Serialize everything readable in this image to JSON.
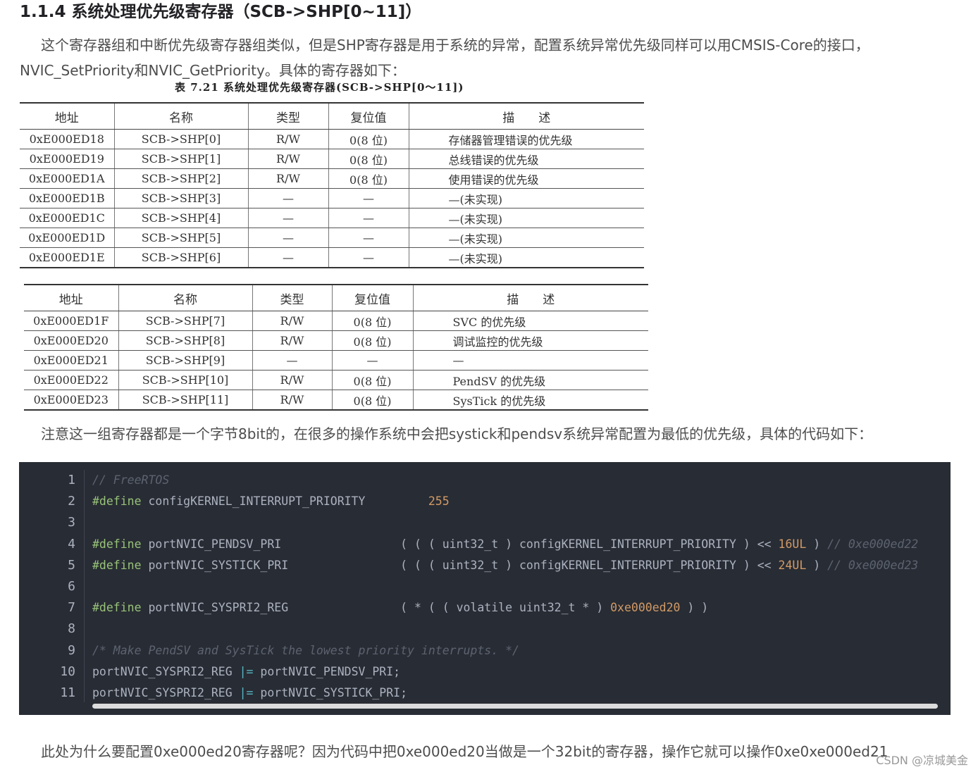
{
  "heading": "1.1.4 系统处理优先级寄存器（SCB->SHP[0~11]）",
  "paragraphs": {
    "intro": "这个寄存器组和中断优先级寄存器组类似，但是SHP寄存器是用于系统的异常，配置系统异常优先级同样可以用CMSIS-Core的接口，NVIC_SetPriority和NVIC_GetPriority。具体的寄存器如下：",
    "note": "注意这一组寄存器都是一个字节8bit的，在很多的操作系统中会把systick和pendsv系统异常配置为最低的优先级，具体的代码如下：",
    "question": "此处为什么要配置0xe000ed20寄存器呢？因为代码中把0xe000ed20当做是一个32bit的寄存器，操作它就可以操作0xe0xe000ed21"
  },
  "table_caption": "表 7.21   系统处理优先级寄存器(SCB->SHP[0～11])",
  "table_headers": [
    "地址",
    "名称",
    "类型",
    "复位值",
    "描　　述"
  ],
  "table1_rows": [
    [
      "0xE000ED18",
      "SCB->SHP[0]",
      "R/W",
      "0(8 位)",
      "存储器管理错误的优先级"
    ],
    [
      "0xE000ED19",
      "SCB->SHP[1]",
      "R/W",
      "0(8 位)",
      "总线错误的优先级"
    ],
    [
      "0xE000ED1A",
      "SCB->SHP[2]",
      "R/W",
      "0(8 位)",
      "使用错误的优先级"
    ],
    [
      "0xE000ED1B",
      "SCB->SHP[3]",
      "—",
      "—",
      "—(未实现)"
    ],
    [
      "0xE000ED1C",
      "SCB->SHP[4]",
      "—",
      "—",
      "—(未实现)"
    ],
    [
      "0xE000ED1D",
      "SCB->SHP[5]",
      "—",
      "—",
      "—(未实现)"
    ],
    [
      "0xE000ED1E",
      "SCB->SHP[6]",
      "—",
      "—",
      "—(未实现)"
    ]
  ],
  "table2_rows": [
    [
      "0xE000ED1F",
      "SCB->SHP[7]",
      "R/W",
      "0(8 位)",
      "SVC 的优先级"
    ],
    [
      "0xE000ED20",
      "SCB->SHP[8]",
      "R/W",
      "0(8 位)",
      "调试监控的优先级"
    ],
    [
      "0xE000ED21",
      "SCB->SHP[9]",
      "—",
      "—",
      "—"
    ],
    [
      "0xE000ED22",
      "SCB->SHP[10]",
      "R/W",
      "0(8 位)",
      "PendSV 的优先级"
    ],
    [
      "0xE000ED23",
      "SCB->SHP[11]",
      "R/W",
      "0(8 位)",
      "SysTick 的优先级"
    ]
  ],
  "code": {
    "line_numbers": [
      "1",
      "2",
      "3",
      "4",
      "5",
      "6",
      "7",
      "8",
      "9",
      "10",
      "11"
    ],
    "lines": [
      [
        {
          "t": "// FreeRTOS",
          "c": "cm"
        }
      ],
      [
        {
          "t": "#define",
          "c": "kw"
        },
        {
          "t": " configKERNEL_INTERRUPT_PRIORITY         ",
          "c": ""
        },
        {
          "t": "255",
          "c": "nb"
        }
      ],
      [],
      [
        {
          "t": "#define",
          "c": "kw"
        },
        {
          "t": " portNVIC_PENDSV_PRI                 ( ( ( uint32_t ) configKERNEL_INTERRUPT_PRIORITY ) << ",
          "c": ""
        },
        {
          "t": "16UL",
          "c": "nb"
        },
        {
          "t": " ) ",
          "c": ""
        },
        {
          "t": "// 0xe000ed22",
          "c": "cm"
        }
      ],
      [
        {
          "t": "#define",
          "c": "kw"
        },
        {
          "t": " portNVIC_SYSTICK_PRI                ( ( ( uint32_t ) configKERNEL_INTERRUPT_PRIORITY ) << ",
          "c": ""
        },
        {
          "t": "24UL",
          "c": "nb"
        },
        {
          "t": " ) ",
          "c": ""
        },
        {
          "t": "// 0xe000ed23",
          "c": "cm"
        }
      ],
      [],
      [
        {
          "t": "#define",
          "c": "kw"
        },
        {
          "t": " portNVIC_SYSPRI2_REG                ( * ( ( volatile uint32_t * ) ",
          "c": ""
        },
        {
          "t": "0xe000ed20",
          "c": "nb"
        },
        {
          "t": " ) )",
          "c": ""
        }
      ],
      [],
      [
        {
          "t": "/* Make PendSV and SysTick the lowest priority interrupts. */",
          "c": "cm"
        }
      ],
      [
        {
          "t": "portNVIC_SYSPRI2_REG ",
          "c": ""
        },
        {
          "t": "|=",
          "c": "op"
        },
        {
          "t": " portNVIC_PENDSV_PRI;",
          "c": ""
        }
      ],
      [
        {
          "t": "portNVIC_SYSPRI2_REG ",
          "c": ""
        },
        {
          "t": "|=",
          "c": "op"
        },
        {
          "t": " portNVIC_SYSTICK_PRI;",
          "c": ""
        }
      ]
    ]
  },
  "watermark": "CSDN @凉城美金"
}
